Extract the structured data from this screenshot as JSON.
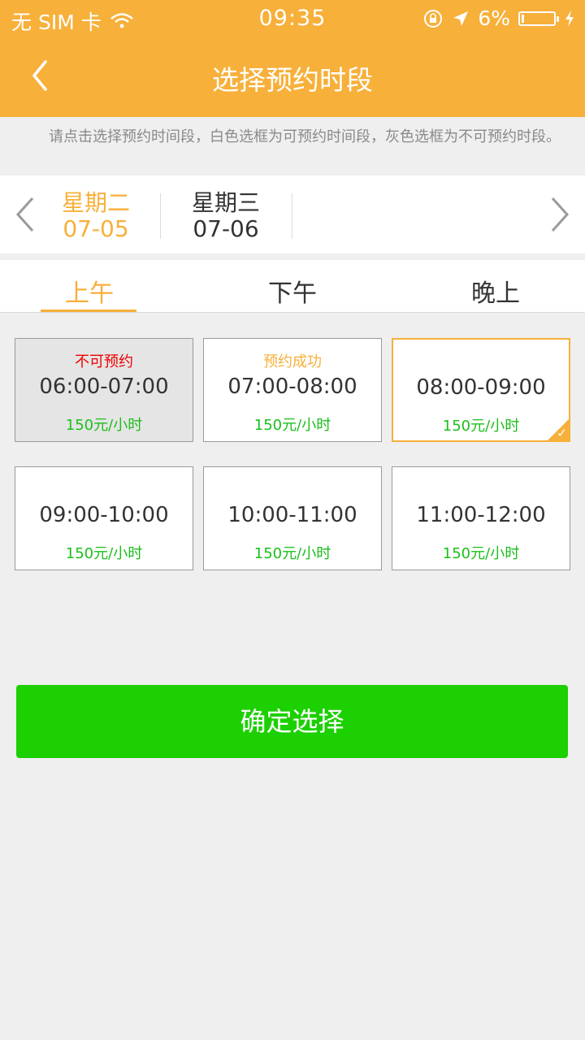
{
  "status_bar": {
    "carrier": "无 SIM 卡",
    "time": "09:35",
    "battery": "6%"
  },
  "header": {
    "title": "选择预约时段"
  },
  "notice": "请点击选择预约时间段，白色选框为可预约时间段，灰色选框为不可预约时段。",
  "dates": [
    {
      "weekday": "星期二",
      "date": "07-05"
    },
    {
      "weekday": "星期三",
      "date": "07-06"
    }
  ],
  "tabs": [
    "上午",
    "下午",
    "晚上"
  ],
  "slots": [
    {
      "status": "不可预约",
      "time": "06:00-07:00",
      "price": "150元/小时"
    },
    {
      "status": "预约成功",
      "time": "07:00-08:00",
      "price": "150元/小时"
    },
    {
      "status": "",
      "time": "08:00-09:00",
      "price": "150元/小时"
    },
    {
      "status": "",
      "time": "09:00-10:00",
      "price": "150元/小时"
    },
    {
      "status": "",
      "time": "10:00-11:00",
      "price": "150元/小时"
    },
    {
      "status": "",
      "time": "11:00-12:00",
      "price": "150元/小时"
    }
  ],
  "confirm_label": "确定选择",
  "colors": {
    "accent": "#f7b03a",
    "confirm": "#1cd002",
    "price": "#1bbf1b",
    "unavailable": "#e00000"
  }
}
